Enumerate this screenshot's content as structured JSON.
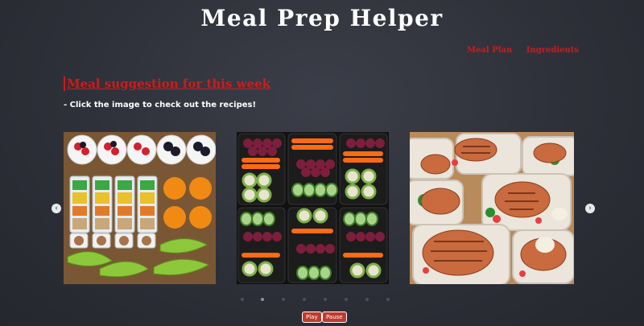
{
  "header": {
    "title": "Meal Prep Helper"
  },
  "nav": {
    "items": [
      {
        "label": "Meal Plan"
      },
      {
        "label": "Ingredients"
      }
    ]
  },
  "main": {
    "section_title": "Meal suggestion for this week",
    "subtitle": "- Click the image to check out the recipes!"
  },
  "slideshow": {
    "slides": [
      {
        "name": "fruit-and-snack-prep"
      },
      {
        "name": "veggie-wrap-boxes"
      },
      {
        "name": "grilled-chicken-boxes"
      }
    ],
    "prev_icon": "chevron-left-icon",
    "next_icon": "chevron-right-icon",
    "prev_glyph": "‹",
    "next_glyph": "›",
    "indicator_count": 8,
    "active_indicator": 1,
    "play_label": "Play",
    "pause_label": "Pause"
  },
  "colors": {
    "accent": "#d11a1a",
    "background": "#2e3039",
    "title": "#ffffff"
  }
}
